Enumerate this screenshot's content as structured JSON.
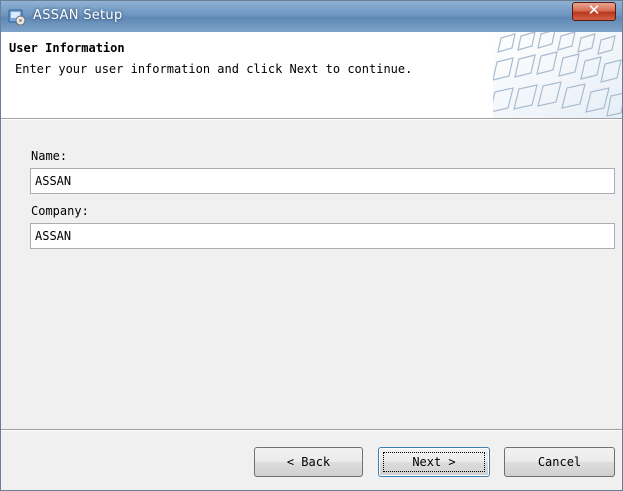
{
  "window": {
    "title": "ASSAN Setup"
  },
  "header": {
    "title": "User Information",
    "description": "Enter your user information and click Next to continue."
  },
  "form": {
    "name_label": "Name:",
    "name_value": "ASSAN",
    "company_label": "Company:",
    "company_value": "ASSAN"
  },
  "buttons": {
    "back": "< Back",
    "next": "Next >",
    "cancel": "Cancel"
  },
  "icons": {
    "app": "setup-installer-icon",
    "close": "close-icon",
    "banner": "keyboard-keys-banner"
  },
  "colors": {
    "titlebar": "#6e96c1",
    "close_button": "#c9472a",
    "default_button_border": "#3c7fb1"
  }
}
